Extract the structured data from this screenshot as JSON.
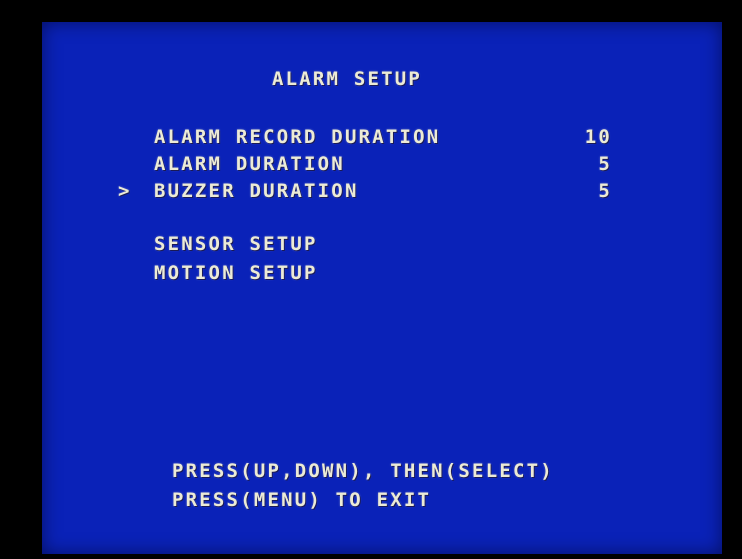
{
  "screen": {
    "title": "ALARM SETUP",
    "cursor_symbol": ">",
    "items": [
      {
        "label": "ALARM RECORD DURATION",
        "value": "10"
      },
      {
        "label": "ALARM DURATION",
        "value": "5"
      },
      {
        "label": "BUZZER DURATION",
        "value": "5"
      }
    ],
    "submenus": [
      {
        "label": "SENSOR SETUP"
      },
      {
        "label": "MOTION SETUP"
      }
    ],
    "footer": {
      "line1": "PRESS(UP,DOWN), THEN(SELECT)",
      "line2": "PRESS(MENU) TO EXIT"
    }
  },
  "colors": {
    "background": "#0a22b8",
    "text": "#ecebd6",
    "bezel": "#000000"
  }
}
